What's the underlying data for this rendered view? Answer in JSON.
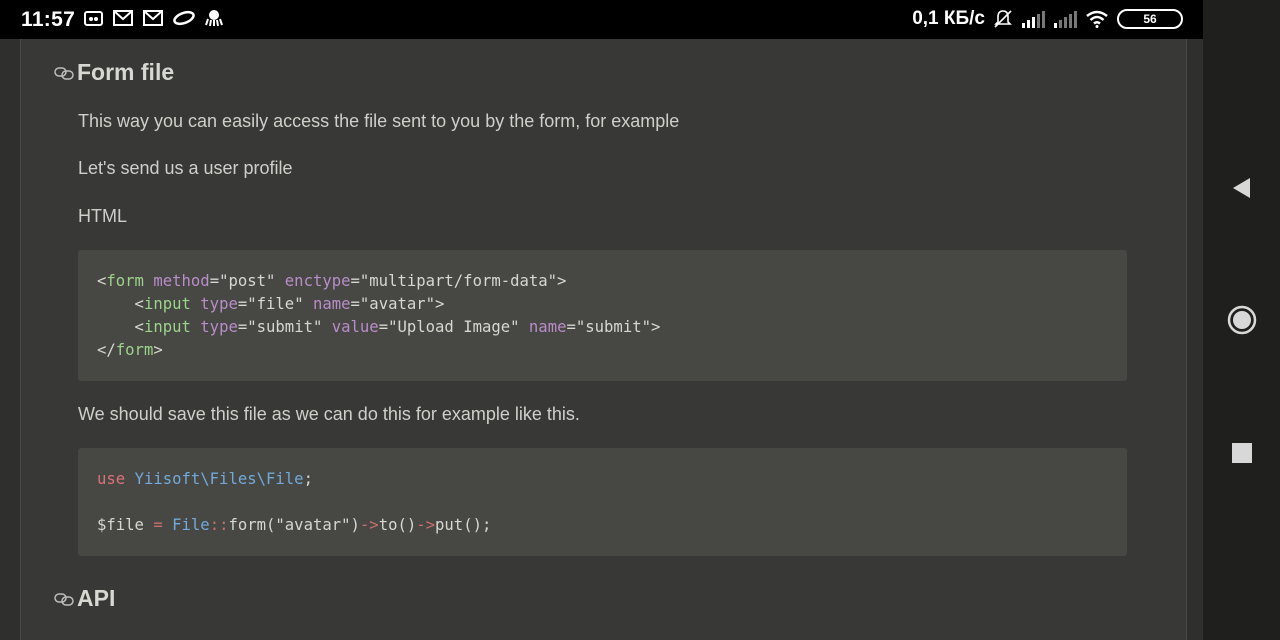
{
  "status_bar": {
    "time": "11:57",
    "network_speed": "0,1 КБ/с",
    "battery": "56",
    "icons": [
      "screen-record-icon",
      "mail-icon",
      "mail-icon",
      "app-icon",
      "octopus-icon",
      "mute-bell-icon",
      "signal-icon",
      "signal-icon",
      "wifi-icon"
    ]
  },
  "content": {
    "section_form_file": {
      "title": "Form file",
      "p1": "This way you can easily access the file sent to you by the form, for example",
      "p2": "Let's send us a user profile",
      "p3": "HTML",
      "p4": "We should save this file as we can do this for example like this."
    },
    "code_html": {
      "lines": [
        "<form method=\"post\" enctype=\"multipart/form-data\">",
        "    <input type=\"file\" name=\"avatar\">",
        "    <input type=\"submit\" value=\"Upload Image\" name=\"submit\">",
        "</form>"
      ]
    },
    "code_php": {
      "line1_kw": "use",
      "line1_ns": "Yiisoft\\Files\\File",
      "line1_end": ";",
      "line3": "$file = File::form(\"avatar\")->to()->put();"
    },
    "section_api": {
      "title": "API"
    }
  },
  "navigation": {
    "back": "back-triangle-icon",
    "home": "home-circle-icon",
    "recents": "recents-square-icon"
  }
}
